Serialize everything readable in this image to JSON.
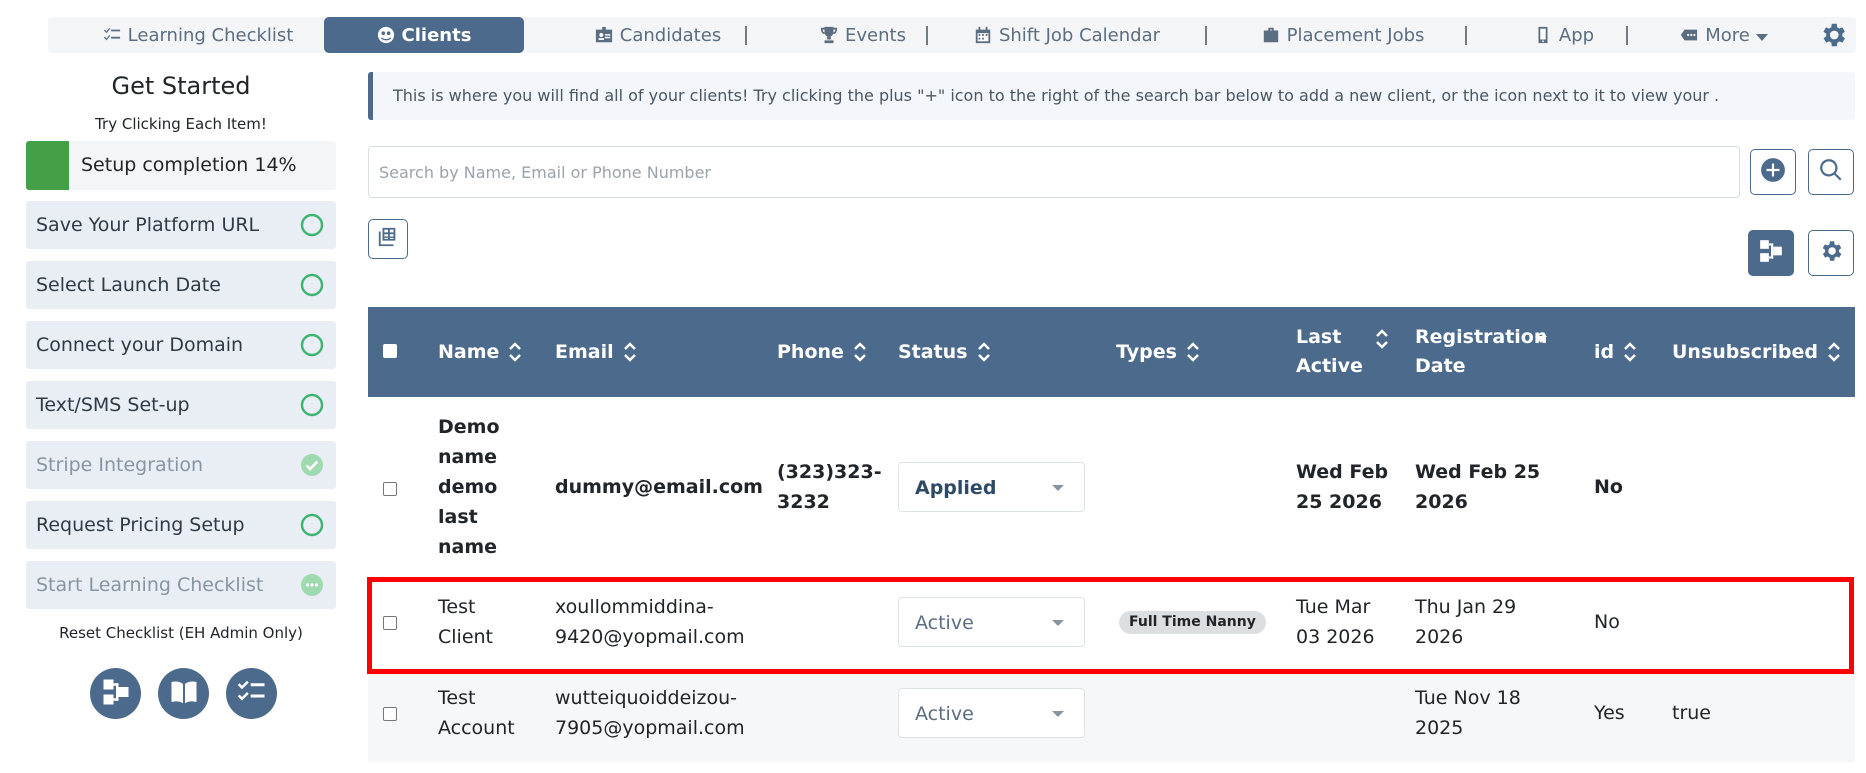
{
  "nav": {
    "items": [
      {
        "label": "Learning Checklist",
        "icon": "checklist-icon"
      },
      {
        "label": "Clients",
        "icon": "clients-icon",
        "active": true
      },
      {
        "label": "Candidates",
        "icon": "id-card-icon"
      },
      {
        "label": "Events",
        "icon": "trophy-icon"
      },
      {
        "label": "Shift Job Calendar",
        "icon": "calendar-icon"
      },
      {
        "label": "Placement Jobs",
        "icon": "briefcase-icon"
      },
      {
        "label": "App",
        "icon": "mobile-icon"
      },
      {
        "label": "More",
        "icon": "tag-icon"
      }
    ],
    "settings_icon": "gear-icon"
  },
  "sidebar": {
    "title": "Get Started",
    "subtitle": "Try Clicking Each Item!",
    "progress": {
      "label": "Setup completion 14%",
      "percent": 14
    },
    "items": [
      {
        "label": "Save Your Platform URL",
        "status": "pending"
      },
      {
        "label": "Select Launch Date",
        "status": "pending"
      },
      {
        "label": "Connect your Domain",
        "status": "pending"
      },
      {
        "label": "Text/SMS Set-up",
        "status": "pending"
      },
      {
        "label": "Stripe Integration",
        "status": "done"
      },
      {
        "label": "Request Pricing Setup",
        "status": "pending"
      },
      {
        "label": "Start Learning Checklist",
        "status": "in-progress"
      }
    ],
    "reset_label": "Reset Checklist (EH Admin Only)",
    "colors": {
      "accent": "#4c6a8c",
      "pending_ring": "#3cb371",
      "done": "#9ed9b0",
      "progress_fill": "#43a047"
    }
  },
  "main": {
    "info": "This is where you will find all of your clients! Try clicking the plus \"+\" icon to the right of the search bar below to add a new client, or the icon next to it to view your .",
    "search": {
      "placeholder": "Search by Name, Email or Phone Number",
      "value": ""
    },
    "table": {
      "columns": [
        "Name",
        "Email",
        "Phone",
        "Status",
        "Types",
        "Last Active",
        "Registration Date",
        "id",
        "Unsubscribed"
      ],
      "rows": [
        {
          "name": "Demo name demo last name",
          "email": "dummy@email.com",
          "phone": "(323)323-3232",
          "status": "Applied",
          "types": "",
          "last_active": "Wed Feb 25 2026",
          "registration_date": "Wed Feb 25 2026",
          "id": "No",
          "unsubscribed": ""
        },
        {
          "name": "Test Client",
          "email": "xoullommiddina-9420@yopmail.com",
          "phone": "",
          "status": "Active",
          "types": "Full Time Nanny",
          "last_active": "Tue Mar 03 2026",
          "registration_date": "Thu Jan 29 2026",
          "id": "No",
          "unsubscribed": ""
        },
        {
          "name": "Test Account",
          "email": "wutteiquoiddeizou-7905@yopmail.com",
          "phone": "",
          "status": "Active",
          "types": "",
          "last_active": "",
          "registration_date": "Tue Nov 18 2025",
          "id": "Yes",
          "unsubscribed": "true"
        }
      ]
    }
  }
}
